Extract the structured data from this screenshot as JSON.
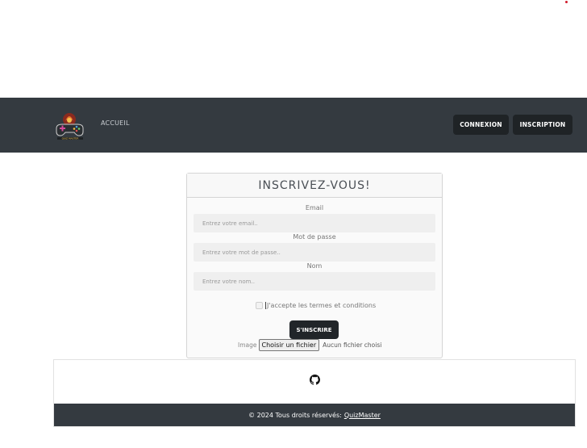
{
  "navbar": {
    "logo_name": "QuizMaster logo",
    "home_link": "ACCUEIL",
    "login_button": "CONNEXION",
    "signup_button": "INSCRIPTION"
  },
  "form": {
    "title": "INSCRIVEZ-VOUS!",
    "email": {
      "label": "Email",
      "placeholder": "Entrez votre email.."
    },
    "password": {
      "label": "Mot de passe",
      "placeholder": "Entrez votre mot de passe.."
    },
    "name": {
      "label": "Nom",
      "placeholder": "Entrez votre nom.."
    },
    "terms_label": "J'accepte les termes et conditions",
    "submit_button": "S'INSCRIRE",
    "image_label": "Image",
    "file_button": "Choisir un fichier",
    "file_status": "Aucun fichier choisi"
  },
  "footer": {
    "icon": "github-icon",
    "copyright": "© 2024 Tous droits réservés:",
    "brand_link": "QuizMaster"
  },
  "colors": {
    "navbar_bg": "#343a40",
    "button_dark": "#212529",
    "accent_red": "#d11a2a"
  }
}
